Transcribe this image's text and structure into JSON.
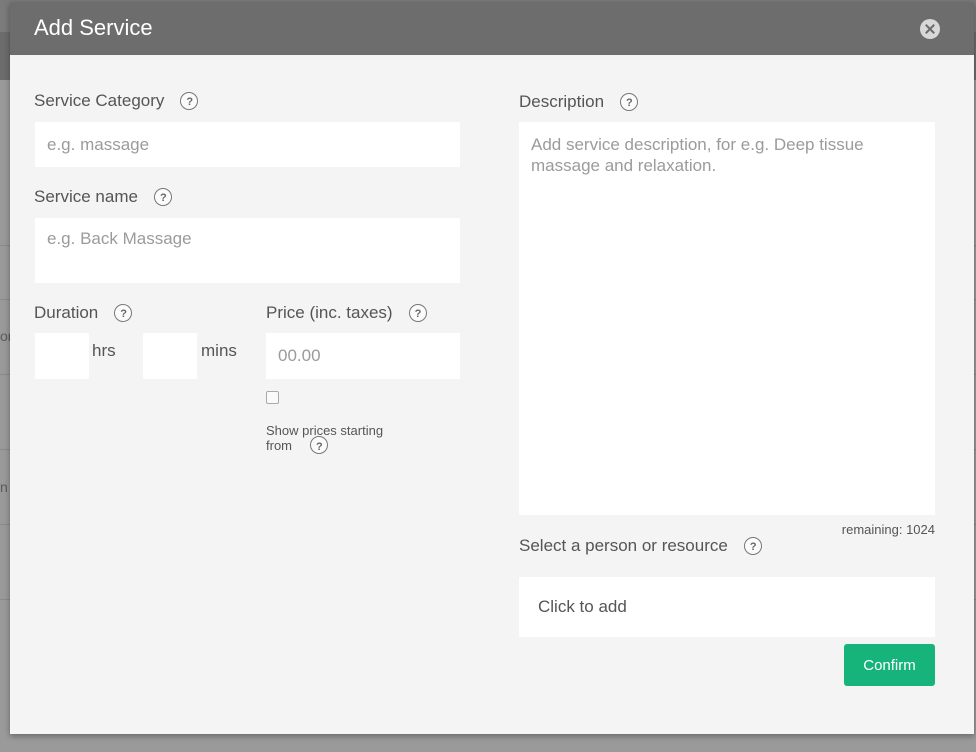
{
  "modal": {
    "title": "Add Service",
    "close_icon": "close-circle-icon"
  },
  "left": {
    "category": {
      "label": "Service Category",
      "placeholder": "e.g. massage"
    },
    "name": {
      "label": "Service name",
      "placeholder": "e.g. Back Massage"
    },
    "duration": {
      "label": "Duration",
      "hrs_unit": "hrs",
      "mins_unit": "mins"
    },
    "price": {
      "label": "Price (inc. taxes)",
      "placeholder": "00.00",
      "starting_from_line1": "Show prices starting",
      "starting_from_line2": "from"
    }
  },
  "right": {
    "description": {
      "label": "Description",
      "placeholder": "Add service description, for e.g. Deep tissue massage and relaxation.",
      "remaining": "remaining: 1024"
    },
    "resource": {
      "label": "Select a person or resource",
      "add_text": "Click to add"
    },
    "confirm_label": "Confirm"
  },
  "background_fragments": {
    "left_1": "or",
    "left_2": "n"
  },
  "colors": {
    "header": "#6d6d6d",
    "modal_bg": "#f4f4f4",
    "confirm": "#16b47a"
  },
  "icons": {
    "help": "help-question-icon"
  }
}
